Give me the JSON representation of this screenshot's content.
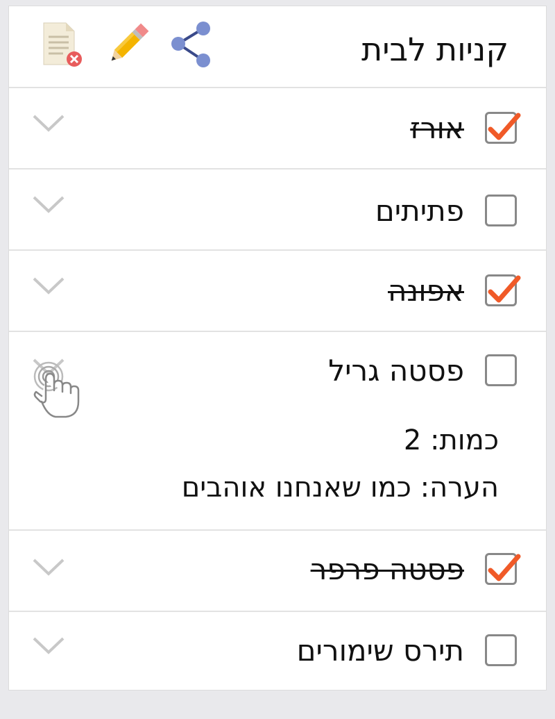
{
  "list": {
    "title": "קניות לבית",
    "icons": {
      "delete": "delete-list-icon",
      "edit": "pencil-icon",
      "share": "share-icon"
    }
  },
  "items": [
    {
      "name": "אורז",
      "checked": true
    },
    {
      "name": "פתיתים",
      "checked": false
    },
    {
      "name": "אפונה",
      "checked": true
    },
    {
      "name": "פסטה גריל",
      "checked": false,
      "expanded": true,
      "quantity_line": "כמות: 2",
      "note_line": "הערה: כמו שאנחנו אוהבים"
    },
    {
      "name": "פסטה פרפר",
      "checked": true
    },
    {
      "name": "תירס שימורים",
      "checked": false
    }
  ],
  "colors": {
    "check": "#f05a28",
    "checkbox_border": "#888888",
    "divider": "#e2e2e2",
    "share": "#7b8fd0",
    "pencil": "#f4b400",
    "background": "#e9e9ec"
  }
}
